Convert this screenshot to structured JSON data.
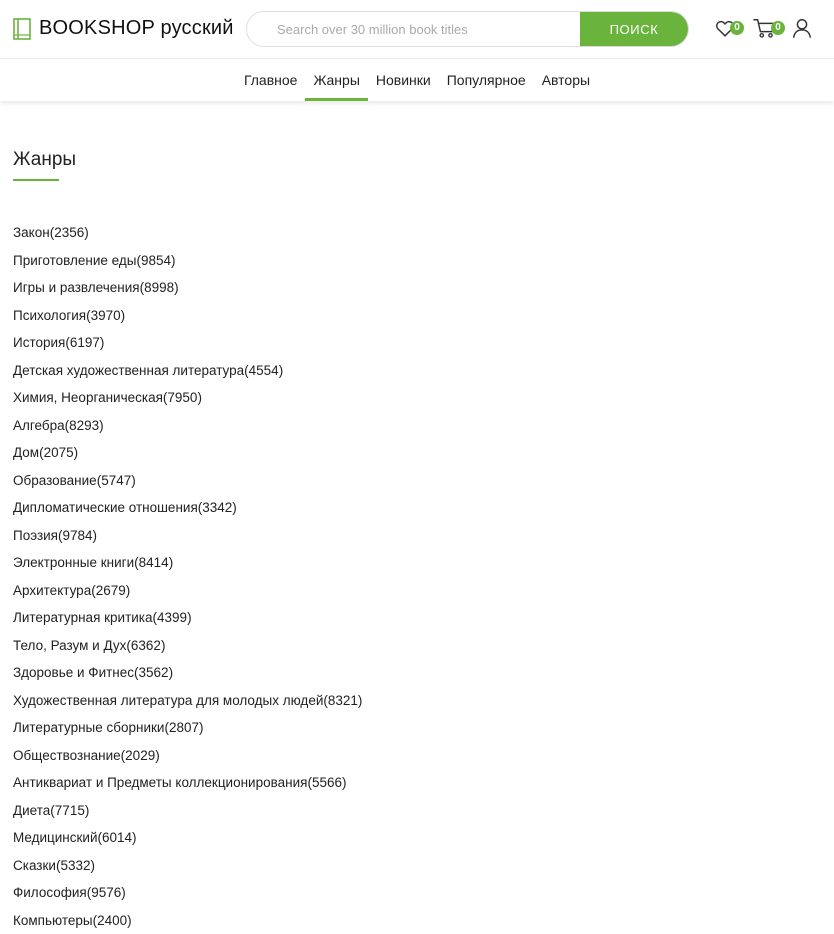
{
  "brand": {
    "name": "BOOKSHOP русский",
    "accent": "#6ab43e"
  },
  "search": {
    "placeholder": "Search over 30 million book titles",
    "button_label": "ПОИСК"
  },
  "header": {
    "favorites_count": "0",
    "cart_count": "0"
  },
  "nav": {
    "items": [
      {
        "label": "Главное"
      },
      {
        "label": "Жанры"
      },
      {
        "label": "Новинки"
      },
      {
        "label": "Популярное"
      },
      {
        "label": "Авторы"
      }
    ],
    "active": "Жанры"
  },
  "page": {
    "title": "Жанры"
  },
  "genres": [
    {
      "name": "Закон",
      "count": "2356"
    },
    {
      "name": "Приготовление еды",
      "count": "9854"
    },
    {
      "name": "Игры и развлечения",
      "count": "8998"
    },
    {
      "name": "Психология",
      "count": "3970"
    },
    {
      "name": "История",
      "count": "6197"
    },
    {
      "name": "Детская художественная литература",
      "count": "4554"
    },
    {
      "name": "Химия, Неорганическая",
      "count": "7950"
    },
    {
      "name": "Алгебра",
      "count": "8293"
    },
    {
      "name": "Дом",
      "count": "2075"
    },
    {
      "name": "Образование",
      "count": "5747"
    },
    {
      "name": "Дипломатические отношения",
      "count": "3342"
    },
    {
      "name": "Поэзия",
      "count": "9784"
    },
    {
      "name": "Электронные книги",
      "count": "8414"
    },
    {
      "name": "Архитектура",
      "count": "2679"
    },
    {
      "name": "Литературная критика",
      "count": "4399"
    },
    {
      "name": "Тело, Разум и Дух",
      "count": "6362"
    },
    {
      "name": "Здоровье и Фитнес",
      "count": "3562"
    },
    {
      "name": "Художественная литература для молодых людей",
      "count": "8321"
    },
    {
      "name": "Литературные сборники",
      "count": "2807"
    },
    {
      "name": "Обществознание",
      "count": "2029"
    },
    {
      "name": "Антиквариат и Предметы коллекционирования",
      "count": "5566"
    },
    {
      "name": "Диета",
      "count": "7715"
    },
    {
      "name": "Медицинский",
      "count": "6014"
    },
    {
      "name": "Сказки",
      "count": "5332"
    },
    {
      "name": "Философия",
      "count": "9576"
    },
    {
      "name": "Компьютеры",
      "count": "2400"
    }
  ]
}
